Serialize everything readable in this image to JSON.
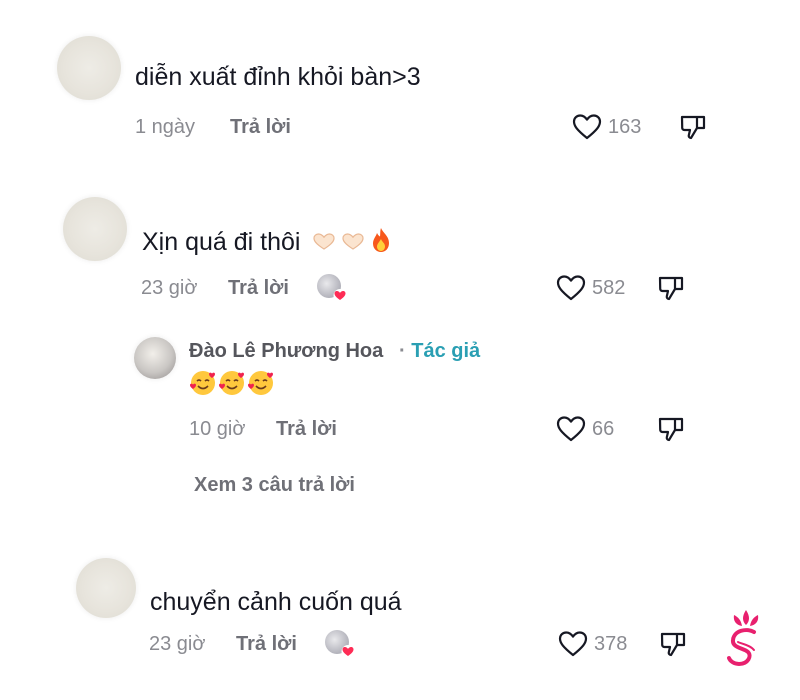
{
  "comments": [
    {
      "text": "diễn xuất đỉnh khỏi bàn>3",
      "time": "1 ngày",
      "reply_label": "Trả lời",
      "likes": "163"
    },
    {
      "text": "Xịn quá đi thôi",
      "emojis": [
        "heart-hands-emoji",
        "heart-hands-emoji",
        "fire-emoji"
      ],
      "time": "23 giờ",
      "reply_label": "Trả lời",
      "likes": "582",
      "reply": {
        "name": "Đào Lê Phương Hoa",
        "separator": "·",
        "author_badge": "Tác giả",
        "emojis": [
          "smiling-face-with-hearts-emoji",
          "smiling-face-with-hearts-emoji",
          "smiling-face-with-hearts-emoji"
        ],
        "time": "10 giờ",
        "reply_label": "Trả lời",
        "likes": "66"
      },
      "view_more": "Xem 3 câu trả lời"
    },
    {
      "text": "chuyển cảnh cuốn quá",
      "time": "23 giờ",
      "reply_label": "Trả lời",
      "likes": "378"
    }
  ],
  "colors": {
    "text": "#161823",
    "muted": "#8a8b91",
    "author": "#2a9fb3",
    "heart": "#fe2c55",
    "logo": "#e8206e"
  }
}
